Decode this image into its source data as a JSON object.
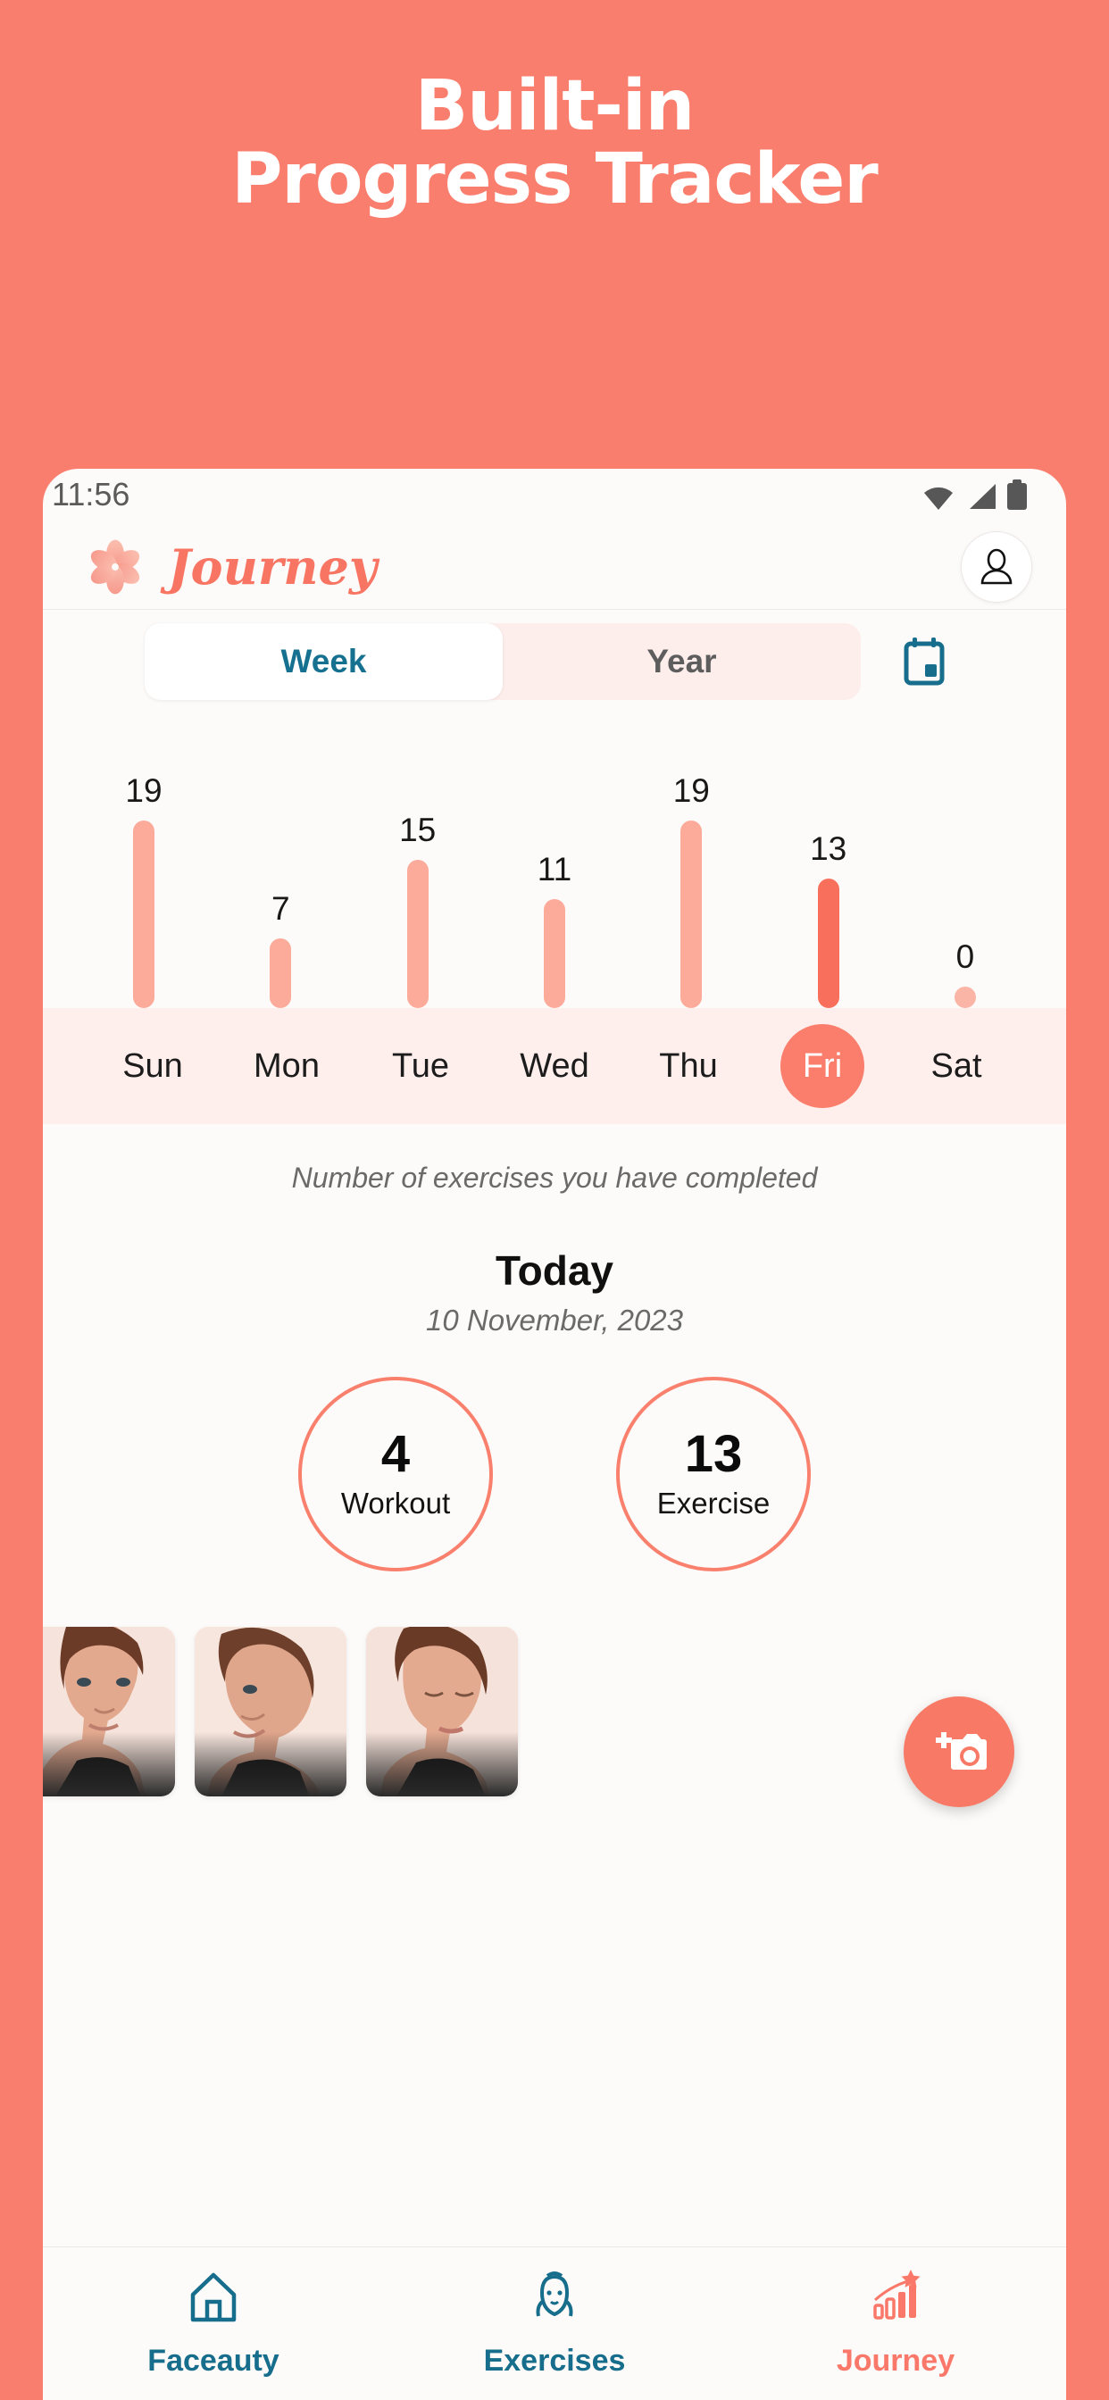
{
  "promo": {
    "line1": "Built-in",
    "line2": "Progress Tracker",
    "background_color": "#FA7E6D",
    "text_color": "#FFFFFF"
  },
  "status_bar": {
    "time": "11:56",
    "icons": [
      "wifi-icon",
      "cellular-signal-icon",
      "battery-icon"
    ]
  },
  "app_header": {
    "logo": "flower-logo-icon",
    "brand": "Journey",
    "brand_color": "#F87563",
    "avatar": "account-avatar-icon"
  },
  "segmented_control": {
    "tabs": [
      {
        "label": "Week",
        "active": true
      },
      {
        "label": "Year",
        "active": false
      }
    ],
    "active_color": "#16708F",
    "inactive_color": "#5D5D5D",
    "calendar_icon": "calendar-icon",
    "calendar_icon_color": "#176D8C"
  },
  "chart_data": {
    "type": "bar",
    "title": "",
    "caption": "Number of exercises you have completed",
    "categories": [
      "Sun",
      "Mon",
      "Tue",
      "Wed",
      "Thu",
      "Fri",
      "Sat"
    ],
    "values": [
      19,
      7,
      15,
      11,
      19,
      13,
      0
    ],
    "highlight_index": 5,
    "highlight_label": "Fri",
    "bar_color": "#FCAB9B",
    "highlight_bar_color": "#F8705C",
    "xlabel": "",
    "ylabel": "",
    "ylim": [
      0,
      19
    ],
    "grid": false,
    "legend": "none"
  },
  "today": {
    "title": "Today",
    "date": "10 November, 2023",
    "stats": [
      {
        "value": "4",
        "label": "Workout"
      },
      {
        "value": "13",
        "label": "Exercise"
      }
    ],
    "stat_ring_color": "#F9806D"
  },
  "photos": {
    "items": [
      {
        "alt": "face-exercise-photo-1"
      },
      {
        "alt": "face-exercise-photo-2"
      },
      {
        "alt": "face-exercise-photo-3"
      }
    ],
    "fab": {
      "icon": "add-photo-camera-icon",
      "color": "#F87A66"
    }
  },
  "bottom_nav": {
    "items": [
      {
        "label": "Faceauty",
        "icon": "home-icon",
        "active": false
      },
      {
        "label": "Exercises",
        "icon": "face-massage-icon",
        "active": false
      },
      {
        "label": "Journey",
        "icon": "progress-chart-icon",
        "active": true
      }
    ],
    "active_color": "#F9786A",
    "inactive_color": "#176D8C"
  }
}
